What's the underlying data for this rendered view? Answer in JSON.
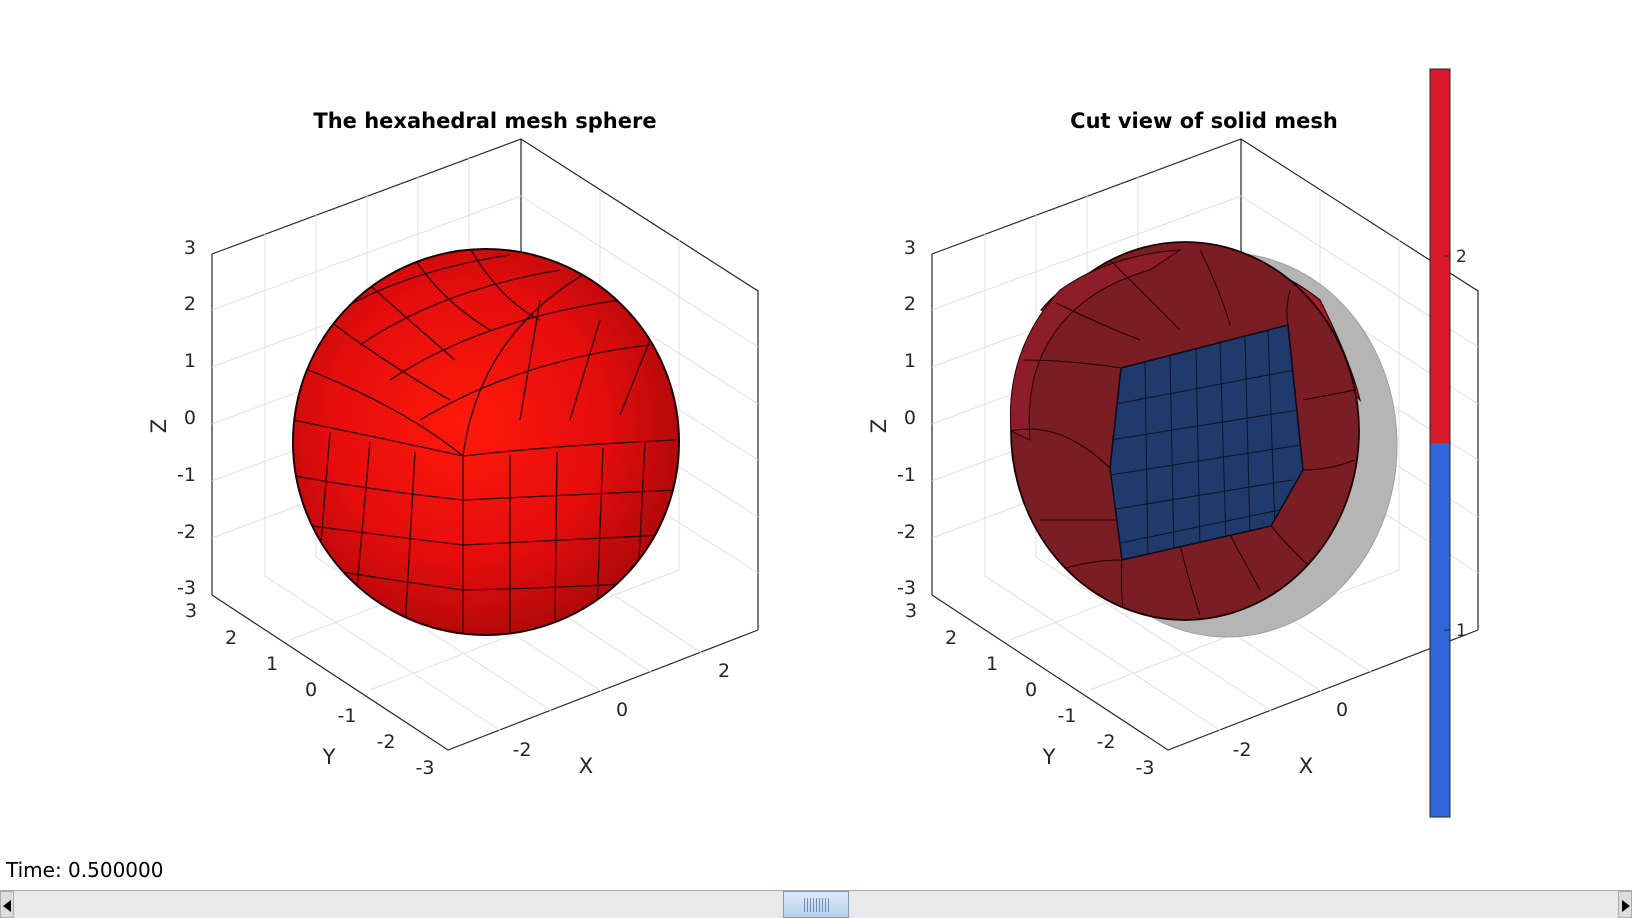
{
  "plots": [
    {
      "title": "The hexahedral mesh sphere",
      "x_label": "X",
      "y_label": "Y",
      "z_label": "Z",
      "z_ticks": [
        "3",
        "2",
        "1",
        "0",
        "-1",
        "-2",
        "-3"
      ],
      "y_ticks": [
        "3",
        "2",
        "1",
        "0",
        "-1",
        "-2",
        "-3"
      ],
      "x_ticks": [
        "-2",
        "0",
        "2"
      ],
      "face_color": "#e40d0d",
      "edge_color": "#000000"
    },
    {
      "title": "Cut view of solid mesh",
      "x_label": "X",
      "y_label": "Y",
      "z_label": "Z",
      "z_ticks": [
        "3",
        "2",
        "1",
        "0",
        "-1",
        "-2",
        "-3"
      ],
      "y_ticks": [
        "3",
        "2",
        "1",
        "0",
        "-1",
        "-2",
        "-3"
      ],
      "x_ticks": [
        "-2",
        "0",
        "2"
      ],
      "outer_color": "#7a1e24",
      "inner_color": "#1f3a6b",
      "ghost_color": "#b5b5b5"
    }
  ],
  "colorbar": {
    "ticks": [
      "2",
      "1"
    ],
    "colors": [
      "#d81a2c",
      "#3166d8"
    ]
  },
  "time_label": "Time: 0.500000",
  "slider": {
    "value": 0.5
  }
}
